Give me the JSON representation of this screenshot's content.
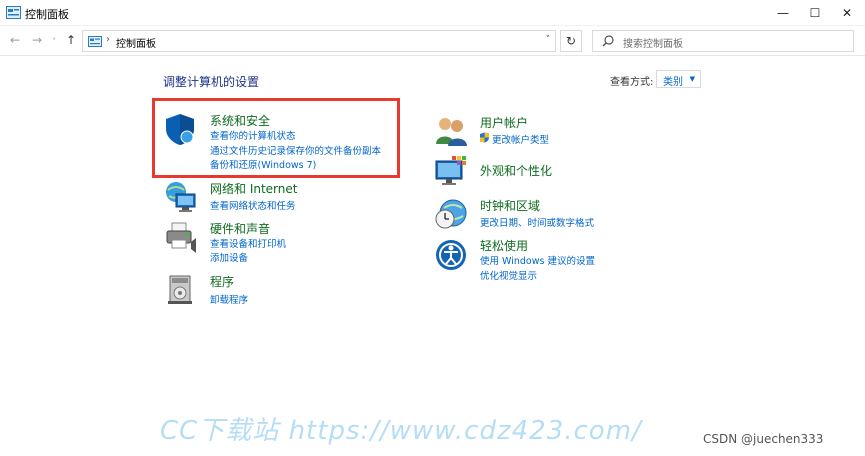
{
  "window": {
    "title": "控制面板",
    "icon": "control-panel-icon"
  },
  "nav": {
    "back": "←",
    "forward": "→",
    "recent": "˅",
    "up": "↑"
  },
  "address": {
    "separator": "›",
    "path": "控制面板",
    "dropdown": "˅",
    "refresh": "↻"
  },
  "search": {
    "placeholder": "搜索控制面板",
    "icon": "search-icon"
  },
  "content": {
    "title": "调整计算机的设置",
    "view_by_label": "查看方式:",
    "view_by_value": "类别",
    "categories_left": [
      {
        "title": "系统和安全",
        "icon": "shield-icon",
        "links": [
          "查看你的计算机状态",
          "通过文件历史记录保存你的文件备份副本",
          "备份和还原(Windows 7)"
        ]
      },
      {
        "title": "网络和 Internet",
        "icon": "network-globe-icon",
        "links": [
          "查看网络状态和任务"
        ]
      },
      {
        "title": "硬件和声音",
        "icon": "printer-icon",
        "links": [
          "查看设备和打印机",
          "添加设备"
        ]
      },
      {
        "title": "程序",
        "icon": "programs-icon",
        "links": [
          "卸载程序"
        ]
      }
    ],
    "categories_right": [
      {
        "title": "用户帐户",
        "icon": "users-icon",
        "links": [
          "更改帐户类型"
        ]
      },
      {
        "title": "外观和个性化",
        "icon": "monitor-palette-icon",
        "links": []
      },
      {
        "title": "时钟和区域",
        "icon": "clock-globe-icon",
        "links": [
          "更改日期、时间或数字格式"
        ]
      },
      {
        "title": "轻松使用",
        "icon": "ease-of-access-icon",
        "links": [
          "使用 Windows 建议的设置",
          "优化视觉显示"
        ]
      }
    ]
  },
  "watermark": "CC下载站 https://www.cdz423.com/",
  "credit": "CSDN @juechen333",
  "colors": {
    "link": "#0066cc",
    "category": "#0e6b1f",
    "title": "#1e3287",
    "highlight": "#e8392e",
    "watermark": "#a9d8f4"
  }
}
